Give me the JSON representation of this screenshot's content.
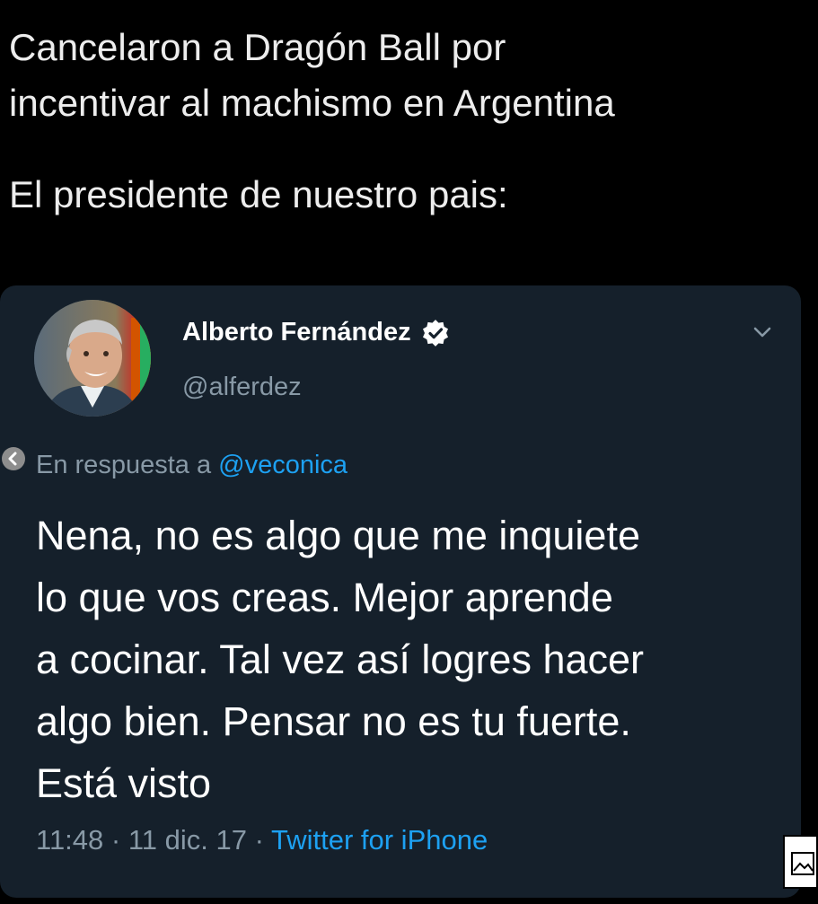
{
  "caption": {
    "line1": "Cancelaron a Dragón Ball por",
    "line2": "incentivar al machismo en Argentina",
    "line3": "El presidente de nuestro pais:"
  },
  "tweet": {
    "author_name": "Alberto Fernández",
    "handle": "@alferdez",
    "reply_prefix": "En respuesta a ",
    "reply_mention": "@veconica",
    "text_lines": [
      "Nena, no es algo que me inquiete",
      "lo que vos creas. Mejor aprende",
      "a cocinar. Tal vez así logres hacer",
      "algo bien. Pensar no es tu fuerte.",
      "Está visto"
    ],
    "time": "11:48",
    "date": "11 dic. 17",
    "separator": " · ",
    "source": "Twitter for iPhone"
  },
  "icons": {
    "verified": "verified-badge-icon",
    "menu": "chevron-down-icon",
    "back": "back-arrow-icon",
    "image": "image-icon"
  },
  "colors": {
    "background": "#000000",
    "card": "#15202b",
    "secondary_text": "#8899a6",
    "link": "#1da1f2"
  }
}
